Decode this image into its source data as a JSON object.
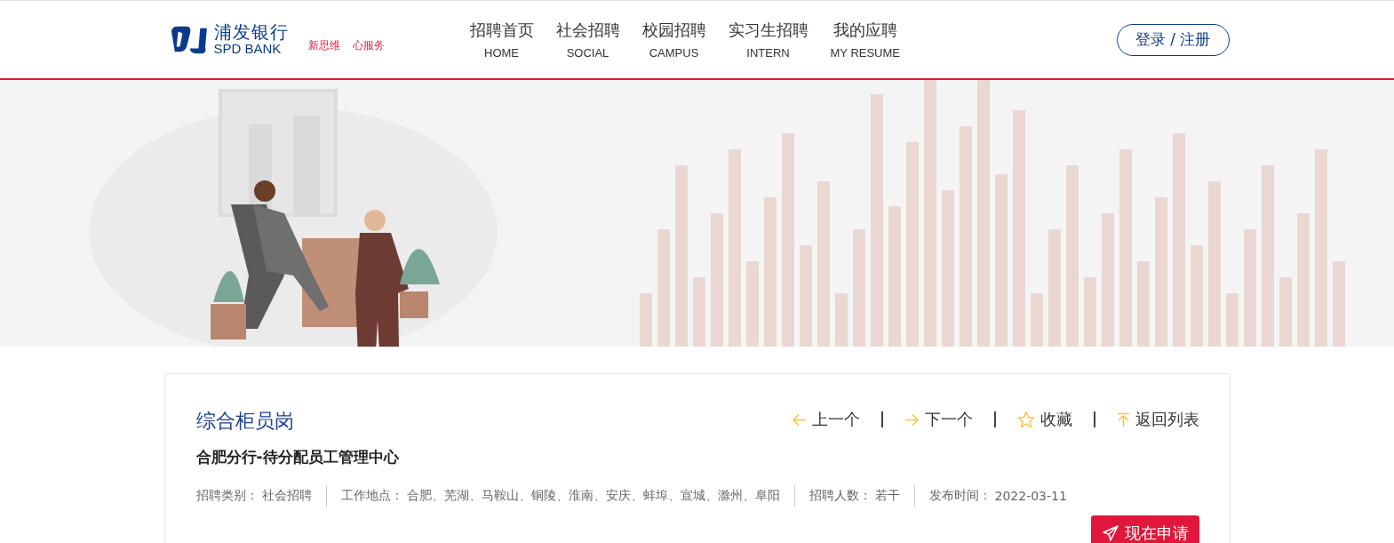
{
  "header": {
    "logo": {
      "name": "浦发银行",
      "name_en": "SPD BANK"
    },
    "slogan": [
      "新思维",
      "心服务"
    ],
    "nav": [
      {
        "label": "招聘首页",
        "label_en": "HOME"
      },
      {
        "label": "社会招聘",
        "label_en": "SOCIAL"
      },
      {
        "label": "校园招聘",
        "label_en": "CAMPUS"
      },
      {
        "label": "实习生招聘",
        "label_en": "INTERN"
      },
      {
        "label": "我的应聘",
        "label_en": "MY RESUME"
      }
    ],
    "login_button": "登录 / 注册"
  },
  "job": {
    "title": "综合柜员岗",
    "department": "合肥分行-待分配员工管理中心",
    "actions": [
      {
        "kind": "prev",
        "label": "上一个"
      },
      {
        "kind": "next",
        "label": "下一个"
      },
      {
        "kind": "favorite",
        "label": "收藏"
      },
      {
        "kind": "back",
        "label": "返回列表"
      }
    ],
    "meta": [
      {
        "label": "招聘类别：",
        "value": "社会招聘"
      },
      {
        "label": "工作地点：",
        "value": "合肥、芜湖、马鞍山、铜陵、淮南、安庆、蚌埠、宣城、滁州、阜阳"
      },
      {
        "label": "招聘人数：",
        "value": "若干"
      },
      {
        "label": "发布时间：",
        "value": "2022-03-11"
      }
    ],
    "apply_button": "现在申请"
  }
}
